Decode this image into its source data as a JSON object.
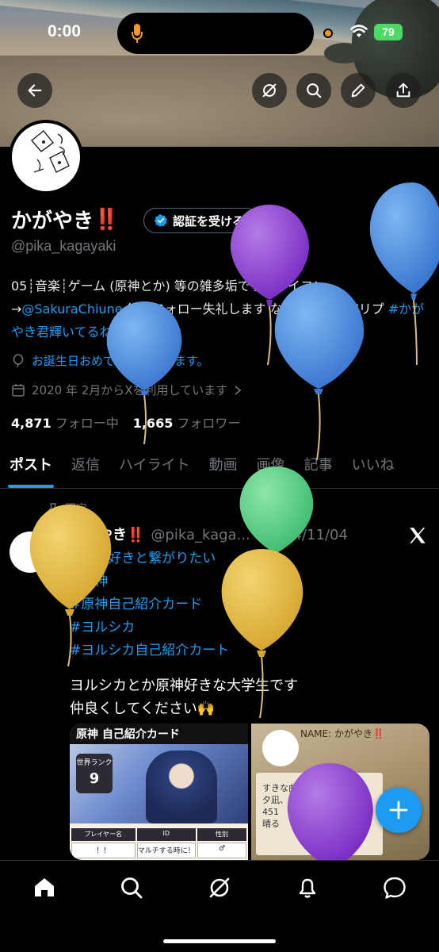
{
  "status": {
    "time": "0:00",
    "battery": "79"
  },
  "profile": {
    "display_name": "かがやき",
    "emoji": "‼️",
    "verify_label": "認証を受ける",
    "handle": "@pika_kagayaki",
    "bio_prefix": "05┊音楽┊ゲーム (原神とか) 等の雑多垢です！アイコン→",
    "bio_mention": "@SakuraChiune",
    "bio_middle": " 無言フォロー失礼します なんかできた空リプ ",
    "bio_hashtag": "#かがやき君輝いてるね",
    "birthday": "お誕生日おめでとうございます。",
    "joined": "2020 年 2月からXを利用しています",
    "following_count": "4,871",
    "following_label": "フォロー中",
    "followers_count": "1,665",
    "followers_label": "フォロワー"
  },
  "tabs": [
    "ポスト",
    "返信",
    "ハイライト",
    "動画",
    "画像",
    "記事",
    "いいね"
  ],
  "post": {
    "pinned_label": "固定",
    "author": "かがやき",
    "author_emoji": "‼️",
    "handle": "@pika_kaga...",
    "date": "· 2024/11/04",
    "hashtags": [
      "#原神好きと繋がりたい",
      "#原神",
      "#原神自己紹介カード",
      "#ヨルシカ",
      "#ヨルシカ自己紹介カート"
    ],
    "text_line1": "ヨルシカとか原神好きな大学生です",
    "text_line2": "仲良くしてください🙌",
    "card1_title": "原神 自己紹介カード",
    "card1_rank_label": "世界ランク",
    "card1_rank_value": "9",
    "card1_cells": [
      "プレイヤー名",
      "ID",
      "性別",
      "！！",
      "マルチする時に！",
      "♂"
    ],
    "card2_name": "NAME: かがやき‼️",
    "card2_note": "すきな曲\n夕凪、Ｍ、花箋\n451\n晴る"
  },
  "colors": {
    "accent": "#1d9bf0",
    "background": "#000000",
    "muted": "#71767b"
  },
  "icons": {
    "back": "back-arrow-icon",
    "no_ads": "circle-slash-icon",
    "search": "search-icon",
    "edit": "pencil-icon",
    "share": "share-icon",
    "home": "home-icon",
    "grok": "grok-icon",
    "bell": "bell-icon",
    "messages": "message-icon",
    "compose": "plus-icon"
  }
}
